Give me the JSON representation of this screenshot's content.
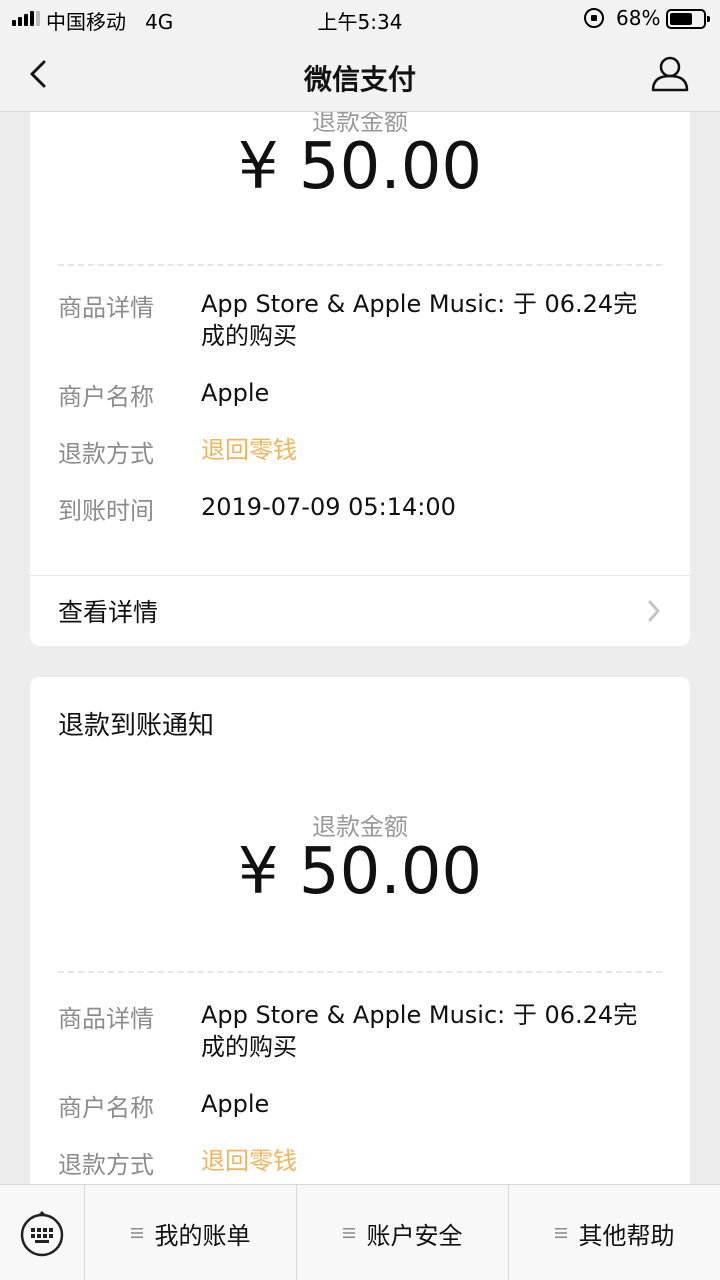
{
  "status_bar": {
    "carrier": "中国移动",
    "network": "4G",
    "time": "上午5:34",
    "battery": "68%"
  },
  "nav": {
    "title": "微信支付"
  },
  "card1": {
    "amount_label": "退款金额",
    "amount": "¥ 50.00",
    "rows": [
      {
        "label": "商品详情",
        "value": "App Store & Apple Music: 于 06.24完成的购买"
      },
      {
        "label": "商户名称",
        "value": "Apple"
      },
      {
        "label": "退款方式",
        "value": "退回零钱"
      },
      {
        "label": "到账时间",
        "value": "2019-07-09 05:14:00"
      }
    ],
    "detail_link": "查看详情"
  },
  "card2": {
    "title": "退款到账通知",
    "amount_label": "退款金额",
    "amount": "¥ 50.00",
    "rows": [
      {
        "label": "商品详情",
        "value": "App Store & Apple Music: 于 06.24完成的购买"
      },
      {
        "label": "商户名称",
        "value": "Apple"
      },
      {
        "label": "退款方式",
        "value": "退回零钱"
      }
    ]
  },
  "bottom_bar": {
    "tabs": [
      {
        "label": "我的账单"
      },
      {
        "label": "账户安全"
      },
      {
        "label": "其他帮助"
      }
    ]
  },
  "colors": {
    "accent_orange": "#f0b45a",
    "background": "#ededed"
  }
}
